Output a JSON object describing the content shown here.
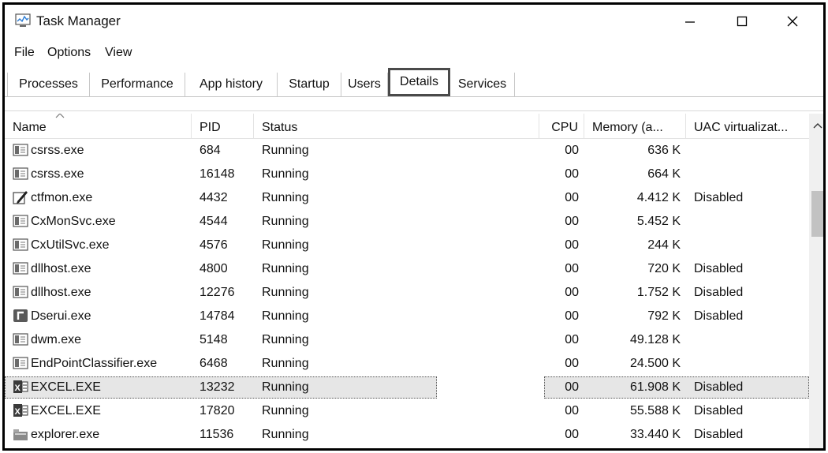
{
  "window": {
    "title": "Task Manager"
  },
  "menu": [
    "File",
    "Options",
    "View"
  ],
  "tabs": [
    {
      "label": "Processes",
      "active": false
    },
    {
      "label": "Performance",
      "active": false
    },
    {
      "label": "App history",
      "active": false
    },
    {
      "label": "Startup",
      "active": false
    },
    {
      "label": "Users",
      "active": false
    },
    {
      "label": "Details",
      "active": true
    },
    {
      "label": "Services",
      "active": false
    }
  ],
  "columns": {
    "name": "Name",
    "pid": "PID",
    "status": "Status",
    "cpu": "CPU",
    "memory": "Memory (a...",
    "uac": "UAC virtualizat..."
  },
  "rows": [
    {
      "name": "csrss.exe",
      "icon": "generic-process-icon",
      "pid": "684",
      "status": "Running",
      "cpu": "00",
      "memory": "636 K",
      "uac": "",
      "selected": false
    },
    {
      "name": "csrss.exe",
      "icon": "generic-process-icon",
      "pid": "16148",
      "status": "Running",
      "cpu": "00",
      "memory": "664 K",
      "uac": "",
      "selected": false
    },
    {
      "name": "ctfmon.exe",
      "icon": "pen-icon",
      "pid": "4432",
      "status": "Running",
      "cpu": "00",
      "memory": "4.412 K",
      "uac": "Disabled",
      "selected": false
    },
    {
      "name": "CxMonSvc.exe",
      "icon": "generic-process-icon",
      "pid": "4544",
      "status": "Running",
      "cpu": "00",
      "memory": "5.452 K",
      "uac": "",
      "selected": false
    },
    {
      "name": "CxUtilSvc.exe",
      "icon": "generic-process-icon",
      "pid": "4576",
      "status": "Running",
      "cpu": "00",
      "memory": "244 K",
      "uac": "",
      "selected": false
    },
    {
      "name": "dllhost.exe",
      "icon": "generic-process-icon",
      "pid": "4800",
      "status": "Running",
      "cpu": "00",
      "memory": "720 K",
      "uac": "Disabled",
      "selected": false
    },
    {
      "name": "dllhost.exe",
      "icon": "generic-process-icon",
      "pid": "12276",
      "status": "Running",
      "cpu": "00",
      "memory": "1.752 K",
      "uac": "Disabled",
      "selected": false
    },
    {
      "name": "Dserui.exe",
      "icon": "dserui-icon",
      "pid": "14784",
      "status": "Running",
      "cpu": "00",
      "memory": "792 K",
      "uac": "Disabled",
      "selected": false
    },
    {
      "name": "dwm.exe",
      "icon": "generic-process-icon",
      "pid": "5148",
      "status": "Running",
      "cpu": "00",
      "memory": "49.128 K",
      "uac": "",
      "selected": false
    },
    {
      "name": "EndPointClassifier.exe",
      "icon": "generic-process-icon",
      "pid": "6468",
      "status": "Running",
      "cpu": "00",
      "memory": "24.500 K",
      "uac": "",
      "selected": false
    },
    {
      "name": "EXCEL.EXE",
      "icon": "excel-icon",
      "pid": "13232",
      "status": "Running",
      "cpu": "00",
      "memory": "61.908 K",
      "uac": "Disabled",
      "selected": true
    },
    {
      "name": "EXCEL.EXE",
      "icon": "excel-icon",
      "pid": "17820",
      "status": "Running",
      "cpu": "00",
      "memory": "55.588 K",
      "uac": "Disabled",
      "selected": false
    },
    {
      "name": "explorer.exe",
      "icon": "folder-icon",
      "pid": "11536",
      "status": "Running",
      "cpu": "00",
      "memory": "33.440 K",
      "uac": "Disabled",
      "selected": false
    }
  ]
}
